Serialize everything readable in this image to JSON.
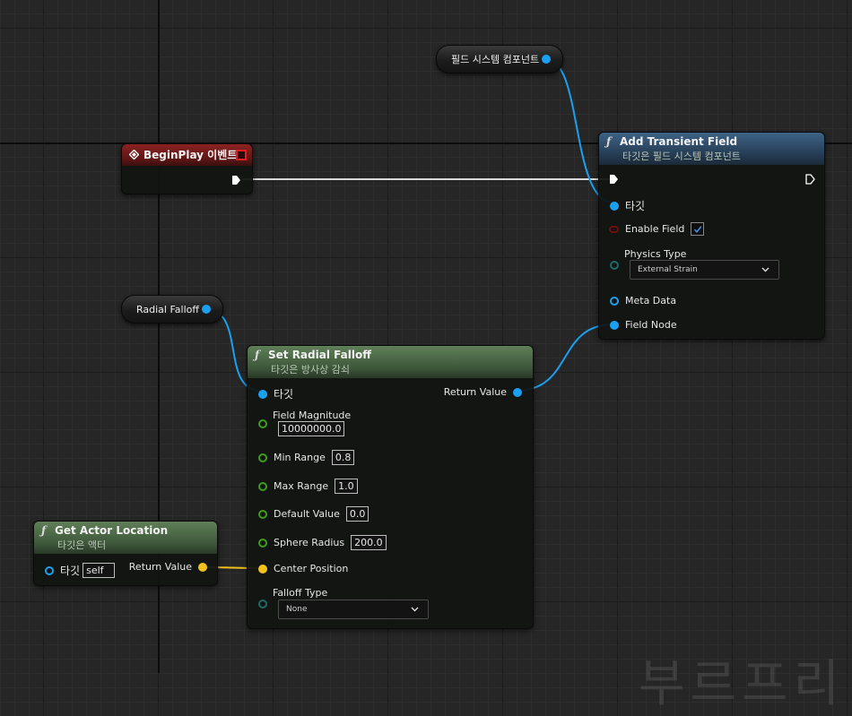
{
  "var_nodes": {
    "field_system": "필드 시스템 컴포넌트",
    "radial_falloff": "Radial Falloff"
  },
  "begin_play": {
    "title": "BeginPlay 이벤트"
  },
  "add_transient_field": {
    "title": "Add Transient Field",
    "subtitle": "타깃은 필드 시스템 컴포넌트",
    "target_label": "타깃",
    "enable_field_label": "Enable Field",
    "enable_field_checked": true,
    "physics_type_label": "Physics Type",
    "physics_type_value": "External Strain",
    "meta_data_label": "Meta Data",
    "field_node_label": "Field Node"
  },
  "set_radial_falloff": {
    "title": "Set Radial Falloff",
    "subtitle": "타깃은 방사상 감쇠",
    "target_label": "타깃",
    "return_label": "Return Value",
    "field_magnitude_label": "Field Magnitude",
    "field_magnitude_value": "10000000.0",
    "min_range_label": "Min Range",
    "min_range_value": "0.8",
    "max_range_label": "Max Range",
    "max_range_value": "1.0",
    "default_value_label": "Default Value",
    "default_value_value": "0.0",
    "sphere_radius_label": "Sphere Radius",
    "sphere_radius_value": "200.0",
    "center_position_label": "Center Position",
    "falloff_type_label": "Falloff Type",
    "falloff_type_value": "None"
  },
  "get_actor_location": {
    "title": "Get Actor Location",
    "subtitle": "타깃은 액터",
    "target_label": "타깃",
    "target_value": "self",
    "return_label": "Return Value"
  },
  "colors": {
    "object_pin": "#1aa0f0",
    "float_pin": "#3e9e18",
    "vector_pin": "#f1c21b",
    "exec_wire": "#ffffff"
  },
  "watermark_text": "부르프리"
}
